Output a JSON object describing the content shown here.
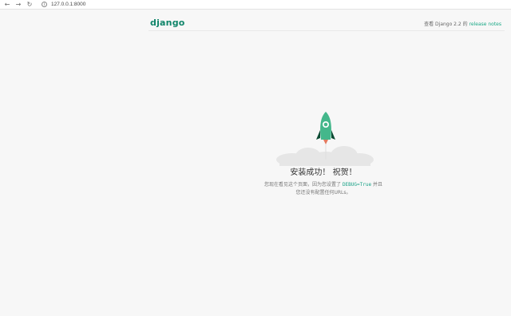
{
  "browser": {
    "url": "127.0.0.1:8000",
    "icons": [
      "back-icon",
      "forward-icon",
      "reload-icon",
      "info-icon"
    ]
  },
  "header": {
    "logo_text": "django",
    "release_prefix": "查看 Django 2.2 的",
    "release_link": "release notes"
  },
  "hero": {
    "title": "安装成功！ 祝贺！",
    "desc_part1": "您现在看见这个页面，因为您设置了",
    "desc_code": "DEBUG=True",
    "desc_part2": "并且",
    "desc_line2": "您还没有配置任何URLs。"
  },
  "colors": {
    "brand": "#10856a",
    "rocket_body": "#44b78b",
    "link": "#19a886",
    "cloud": "#e8e8e8"
  }
}
